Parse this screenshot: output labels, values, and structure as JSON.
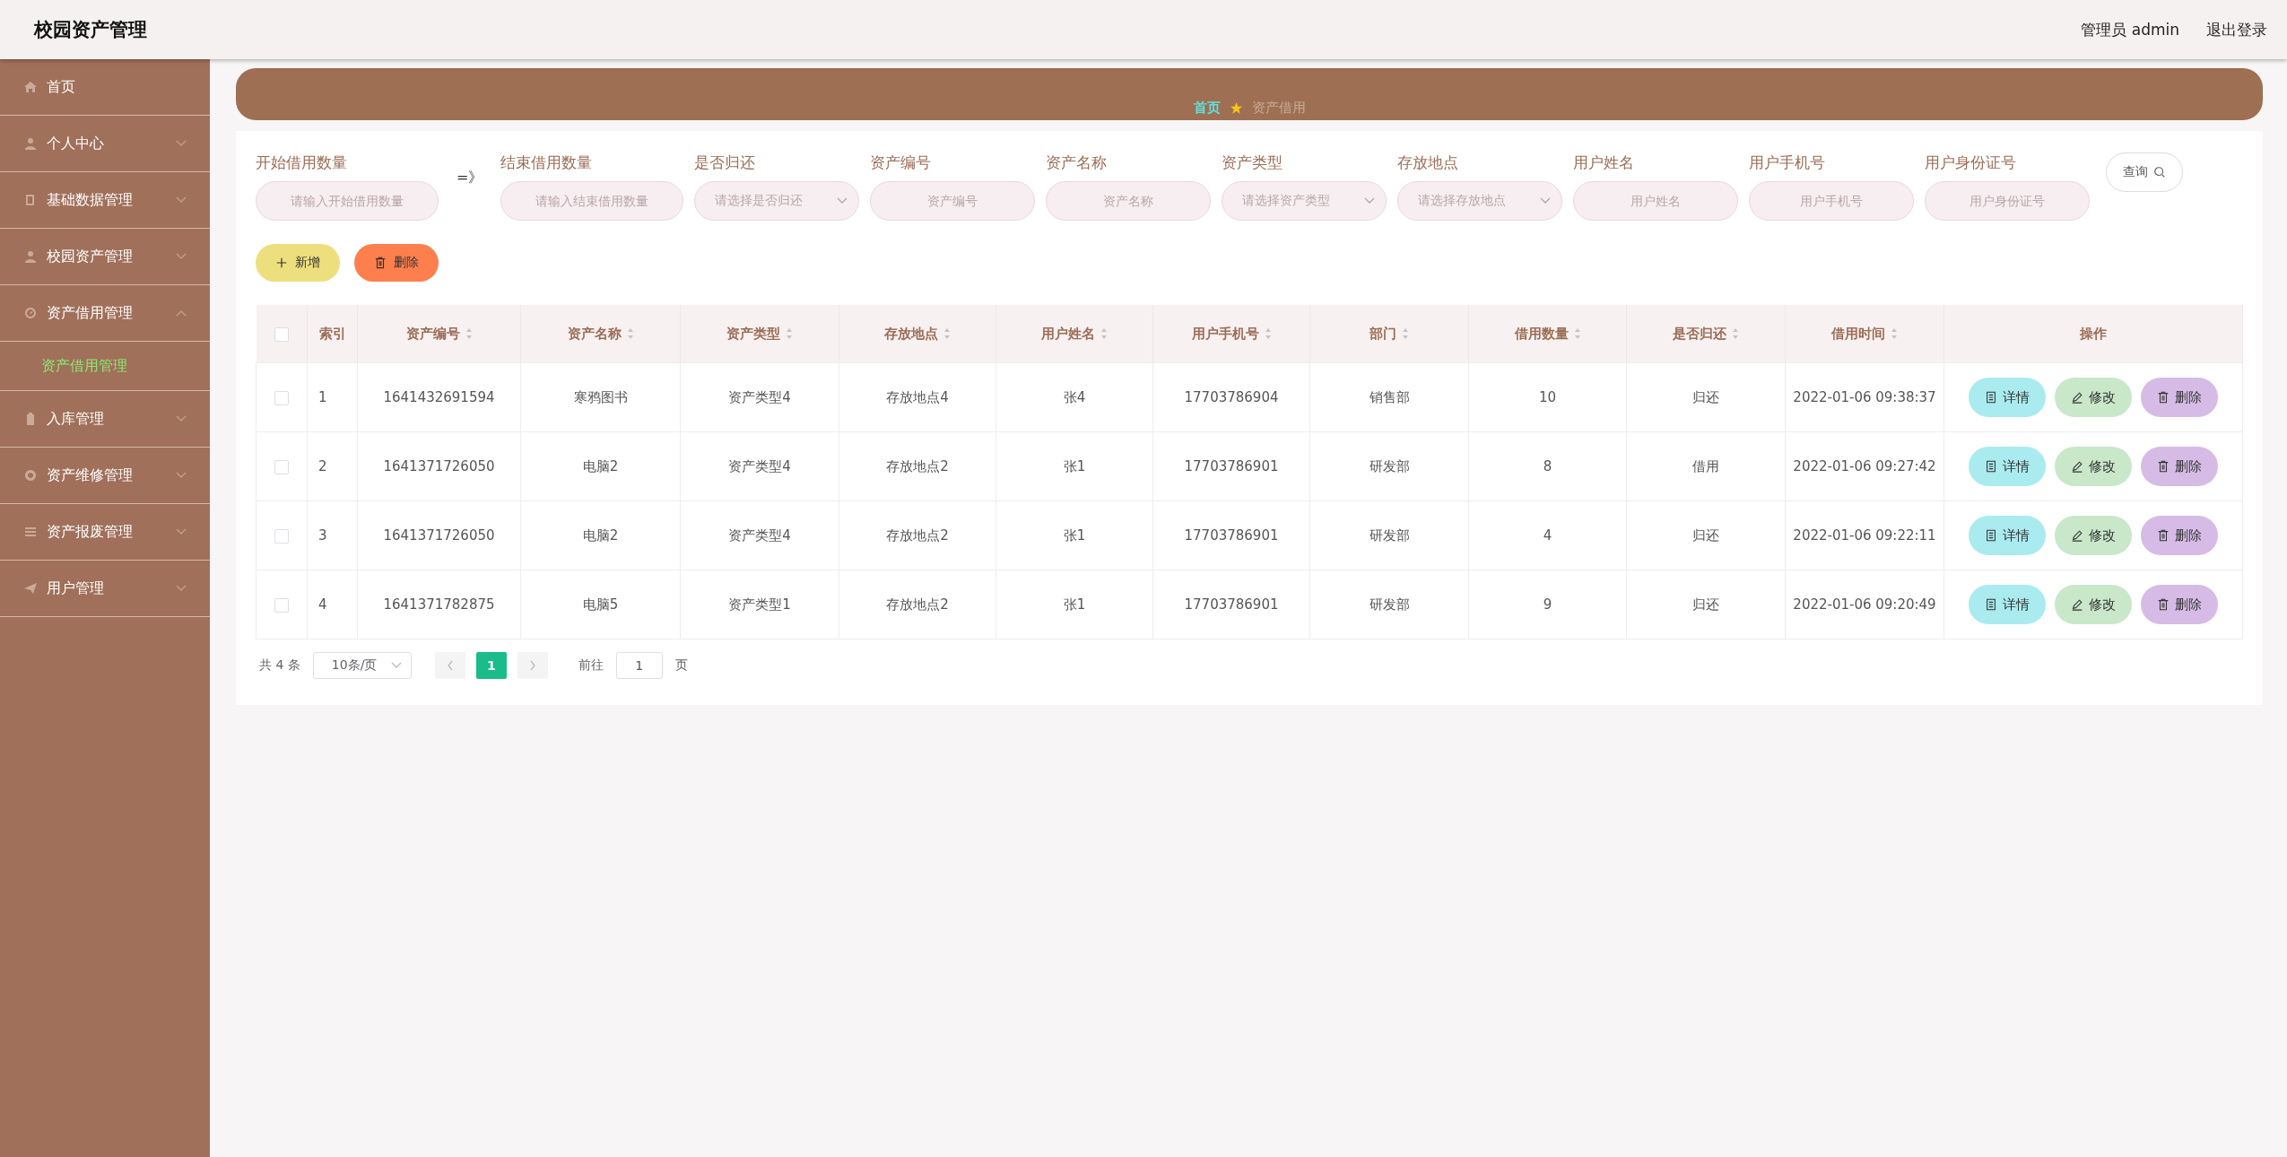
{
  "header": {
    "title": "校园资产管理",
    "user": "管理员 admin",
    "logout": "退出登录"
  },
  "sidebar": {
    "items": [
      {
        "label": "首页",
        "kind": "link"
      },
      {
        "label": "个人中心",
        "kind": "submenu",
        "expanded": false
      },
      {
        "label": "基础数据管理",
        "kind": "submenu",
        "expanded": false
      },
      {
        "label": "校园资产管理",
        "kind": "submenu",
        "expanded": false
      },
      {
        "label": "资产借用管理",
        "kind": "submenu",
        "expanded": true,
        "children": [
          {
            "label": "资产借用管理",
            "selected": true
          }
        ]
      },
      {
        "label": "入库管理",
        "kind": "submenu",
        "expanded": false
      },
      {
        "label": "资产维修管理",
        "kind": "submenu",
        "expanded": false
      },
      {
        "label": "资产报废管理",
        "kind": "submenu",
        "expanded": false
      },
      {
        "label": "用户管理",
        "kind": "submenu",
        "expanded": false
      }
    ]
  },
  "breadcrumb": [
    {
      "label": "首页",
      "kind": "link"
    },
    {
      "label": "资产借用",
      "kind": "current"
    }
  ],
  "search": {
    "range": {
      "from": {
        "label": "开始借用数量",
        "placeholder": "请输入开始借用数量"
      },
      "separator": "=》",
      "to": {
        "label": "结束借用数量",
        "placeholder": "请输入结束借用数量"
      }
    },
    "fields": [
      {
        "label": "是否归还",
        "placeholder": "请选择是否归还",
        "kind": "select"
      },
      {
        "label": "资产编号",
        "placeholder": "资产编号",
        "kind": "input"
      },
      {
        "label": "资产名称",
        "placeholder": "资产名称",
        "kind": "input"
      },
      {
        "label": "资产类型",
        "placeholder": "请选择资产类型",
        "kind": "select"
      },
      {
        "label": "存放地点",
        "placeholder": "请选择存放地点",
        "kind": "select"
      },
      {
        "label": "用户姓名",
        "placeholder": "用户姓名",
        "kind": "input"
      },
      {
        "label": "用户手机号",
        "placeholder": "用户手机号",
        "kind": "input"
      },
      {
        "label": "用户身份证号",
        "placeholder": "用户身份证号",
        "kind": "input"
      }
    ],
    "button": "查询"
  },
  "toolbar": [
    {
      "label": "新增",
      "kind": "add"
    },
    {
      "label": "删除",
      "kind": "delete"
    }
  ],
  "table": {
    "select_all": {
      "checked": false
    },
    "columns": [
      {
        "label": "索引",
        "sortable": false
      },
      {
        "label": "资产编号",
        "sortable": true
      },
      {
        "label": "资产名称",
        "sortable": true
      },
      {
        "label": "资产类型",
        "sortable": true
      },
      {
        "label": "存放地点",
        "sortable": true
      },
      {
        "label": "用户姓名",
        "sortable": true
      },
      {
        "label": "用户手机号",
        "sortable": true
      },
      {
        "label": "部门",
        "sortable": true
      },
      {
        "label": "借用数量",
        "sortable": true
      },
      {
        "label": "是否归还",
        "sortable": true
      },
      {
        "label": "借用时间",
        "sortable": true
      },
      {
        "label": "操作",
        "sortable": false
      }
    ],
    "rows": [
      {
        "checked": false,
        "cells": [
          "1",
          "1641432691594",
          "寒鸦图书",
          "资产类型4",
          "存放地点4",
          "张4",
          "17703786904",
          "销售部",
          "10",
          "归还",
          "2022-01-06 09:38:37"
        ],
        "actions": [
          {
            "label": "详情",
            "kind": "detail"
          },
          {
            "label": "修改",
            "kind": "edit"
          },
          {
            "label": "删除",
            "kind": "delete"
          }
        ]
      },
      {
        "checked": false,
        "cells": [
          "2",
          "1641371726050",
          "电脑2",
          "资产类型4",
          "存放地点2",
          "张1",
          "17703786901",
          "研发部",
          "8",
          "借用",
          "2022-01-06 09:27:42"
        ],
        "actions": [
          {
            "label": "详情",
            "kind": "detail"
          },
          {
            "label": "修改",
            "kind": "edit"
          },
          {
            "label": "删除",
            "kind": "delete"
          }
        ]
      },
      {
        "checked": false,
        "cells": [
          "3",
          "1641371726050",
          "电脑2",
          "资产类型4",
          "存放地点2",
          "张1",
          "17703786901",
          "研发部",
          "4",
          "归还",
          "2022-01-06 09:22:11"
        ],
        "actions": [
          {
            "label": "详情",
            "kind": "detail"
          },
          {
            "label": "修改",
            "kind": "edit"
          },
          {
            "label": "删除",
            "kind": "delete"
          }
        ]
      },
      {
        "checked": false,
        "cells": [
          "4",
          "1641371782875",
          "电脑5",
          "资产类型1",
          "存放地点2",
          "张1",
          "17703786901",
          "研发部",
          "9",
          "归还",
          "2022-01-06 09:20:49"
        ],
        "actions": [
          {
            "label": "详情",
            "kind": "detail"
          },
          {
            "label": "修改",
            "kind": "edit"
          },
          {
            "label": "删除",
            "kind": "delete"
          }
        ]
      }
    ]
  },
  "pagination": {
    "total": "共 4 条",
    "page_size": "10条/页",
    "pages": [
      {
        "label": "1",
        "selected": true
      }
    ],
    "goto": "前往",
    "goto_value": "1",
    "goto_suffix": "页"
  }
}
